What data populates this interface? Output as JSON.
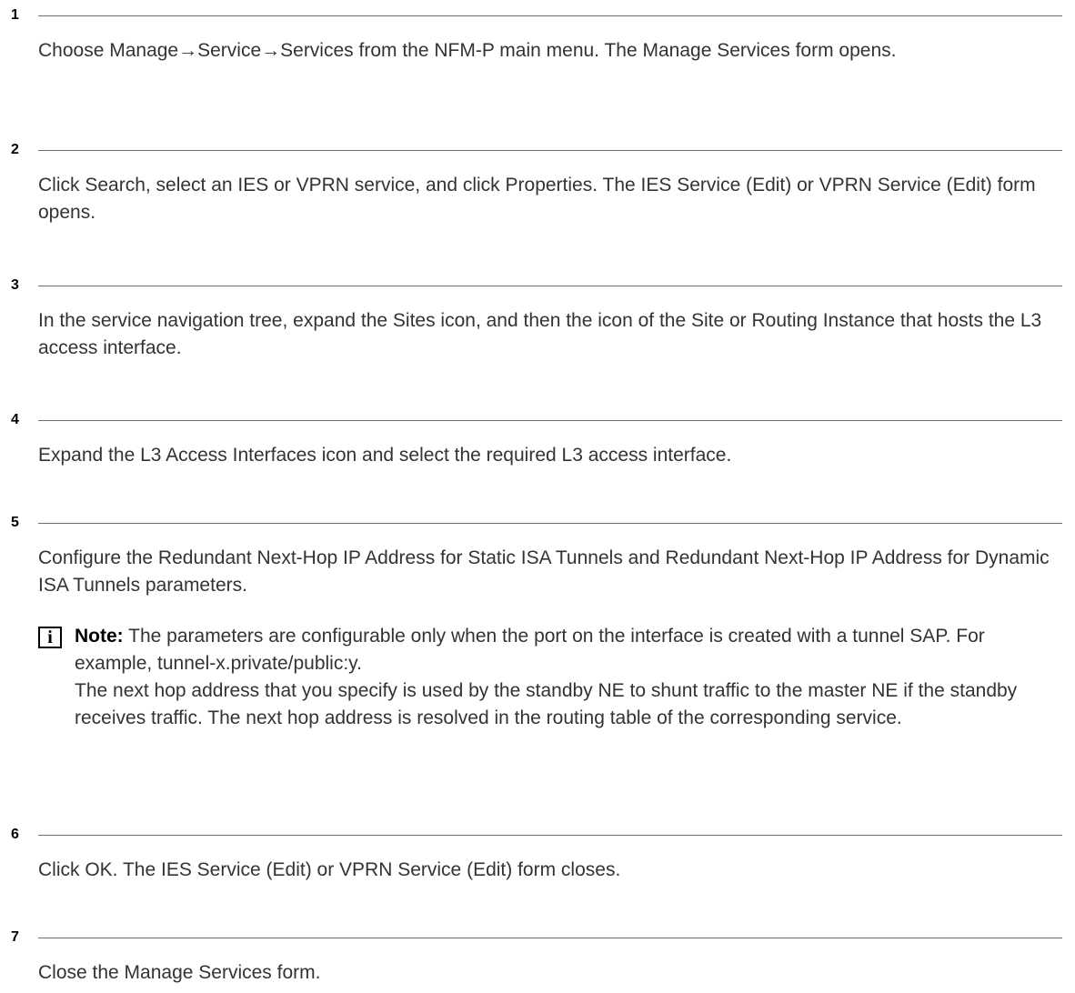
{
  "steps": [
    {
      "number": "1",
      "text": "Choose Manage→Service→Services from the NFM-P main menu. The Manage Services form opens."
    },
    {
      "number": "2",
      "text": "Click Search, select an IES or VPRN service, and click Properties. The IES Service (Edit) or VPRN Service (Edit) form opens."
    },
    {
      "number": "3",
      "text": "In the service navigation tree, expand the Sites icon, and then the icon of the Site or Routing Instance that hosts the L3 access interface."
    },
    {
      "number": "4",
      "text": "Expand the L3 Access Interfaces icon and select the required L3 access interface."
    },
    {
      "number": "5",
      "text": "Configure the Redundant Next-Hop IP Address for Static ISA Tunnels and Redundant Next-Hop IP Address for Dynamic ISA Tunnels parameters.",
      "note": {
        "icon": "info-icon",
        "icon_glyph": "i",
        "label": "Note:",
        "text1": "The parameters are configurable only when the port on the interface is created with a tunnel SAP. For example, tunnel-x.private/public:y.",
        "text2": "The next hop address that you specify is used by the standby NE to shunt traffic to the master NE if the standby receives traffic. The next hop address is resolved in the routing table of the corresponding service."
      }
    },
    {
      "number": "6",
      "text": "Click OK. The IES Service (Edit) or VPRN Service (Edit) form closes."
    },
    {
      "number": "7",
      "text": "Close the Manage Services form."
    }
  ]
}
